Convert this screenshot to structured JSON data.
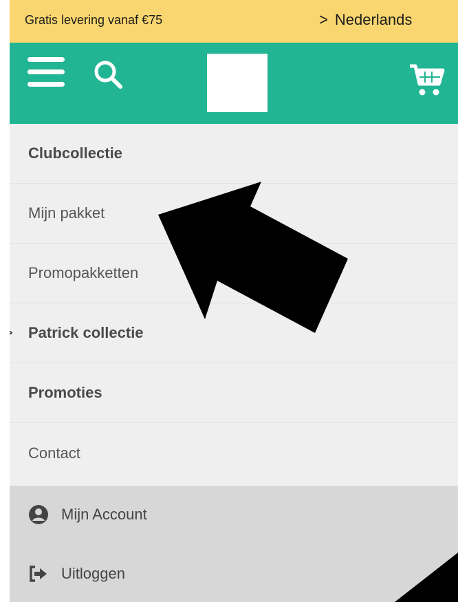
{
  "topbar": {
    "promo_text": "Gratis levering vanaf €75",
    "language_label": "Nederlands"
  },
  "header": {
    "icons": [
      "hamburger-icon",
      "search-icon",
      "cart-icon"
    ],
    "accent": "#21b594",
    "topbar_color": "#f9d66f"
  },
  "menu": {
    "items": [
      {
        "label": "Clubcollectie",
        "bold": true
      },
      {
        "label": "Mijn pakket",
        "bold": false
      },
      {
        "label": "Promopakketten",
        "bold": false
      },
      {
        "label": "Patrick collectie",
        "bold": true,
        "expandable": true
      },
      {
        "label": "Promoties",
        "bold": true
      },
      {
        "label": "Contact",
        "bold": false
      }
    ]
  },
  "account": {
    "my_account_label": "Mijn Account",
    "logout_label": "Uitloggen",
    "icons": [
      "user-circle-icon",
      "logout-icon"
    ]
  }
}
